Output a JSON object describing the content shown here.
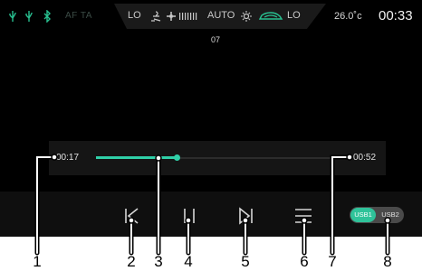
{
  "status_bar": {
    "icons": [
      "usb-icon",
      "usb-icon",
      "bluetooth-icon"
    ],
    "af_ta": "AF TA",
    "climate": {
      "left_temp": "LO",
      "fan_mode": "AUTO",
      "right_temp": "LO",
      "icons": [
        "fan-direction-icon",
        "fan-speed-icon",
        "sun-icon",
        "recirculation-car-icon"
      ]
    },
    "outside_temp": "26.0˚c",
    "clock": "00:33"
  },
  "player": {
    "track_number": "07",
    "elapsed": "00:17",
    "total": "00:52",
    "progress": 0.327
  },
  "controls": {
    "icons": [
      "previous-icon",
      "pause-icon",
      "next-icon",
      "playlist-icon"
    ],
    "usb1_label": "USB1",
    "usb2_label": "USB2",
    "active_source": "USB1"
  },
  "callouts": [
    "1",
    "2",
    "3",
    "4",
    "5",
    "6",
    "7",
    "8"
  ],
  "colors": {
    "accent": "#30d0a8",
    "background": "#000000"
  }
}
